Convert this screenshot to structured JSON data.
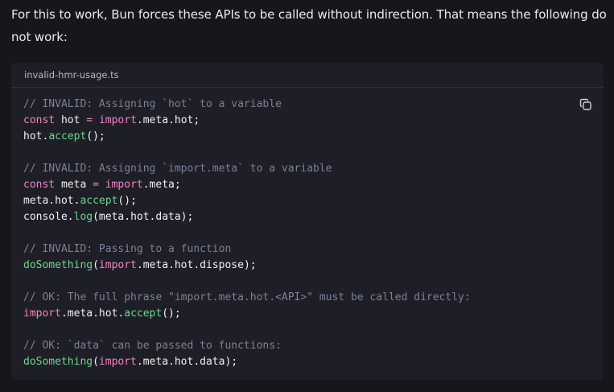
{
  "intro": {
    "text": "For this to work, Bun forces these APIs to be called without indirection. That means the following do not work:"
  },
  "code_block": {
    "filename": "invalid-hmr-usage.ts",
    "copy_icon": "copy-icon",
    "colors": {
      "background": "#1e1f26",
      "comment": "#7a7f9a",
      "keyword": "#f283c4",
      "function": "#6dd58c",
      "text": "#f1f1f3"
    },
    "lines": [
      [
        {
          "t": "comment",
          "v": "// INVALID: Assigning `hot` to a variable"
        }
      ],
      [
        {
          "t": "keyword",
          "v": "const"
        },
        {
          "t": "plain",
          "v": " hot "
        },
        {
          "t": "keyword",
          "v": "="
        },
        {
          "t": "plain",
          "v": " "
        },
        {
          "t": "keyword",
          "v": "import"
        },
        {
          "t": "plain",
          "v": ".meta.hot;"
        }
      ],
      [
        {
          "t": "plain",
          "v": "hot."
        },
        {
          "t": "function",
          "v": "accept"
        },
        {
          "t": "plain",
          "v": "();"
        }
      ],
      [],
      [
        {
          "t": "comment",
          "v": "// INVALID: Assigning `import.meta` to a variable"
        }
      ],
      [
        {
          "t": "keyword",
          "v": "const"
        },
        {
          "t": "plain",
          "v": " meta "
        },
        {
          "t": "keyword",
          "v": "="
        },
        {
          "t": "plain",
          "v": " "
        },
        {
          "t": "keyword",
          "v": "import"
        },
        {
          "t": "plain",
          "v": ".meta;"
        }
      ],
      [
        {
          "t": "plain",
          "v": "meta.hot."
        },
        {
          "t": "function",
          "v": "accept"
        },
        {
          "t": "plain",
          "v": "();"
        }
      ],
      [
        {
          "t": "plain",
          "v": "console."
        },
        {
          "t": "function",
          "v": "log"
        },
        {
          "t": "plain",
          "v": "(meta.hot.data);"
        }
      ],
      [],
      [
        {
          "t": "comment",
          "v": "// INVALID: Passing to a function"
        }
      ],
      [
        {
          "t": "function",
          "v": "doSomething"
        },
        {
          "t": "plain",
          "v": "("
        },
        {
          "t": "keyword",
          "v": "import"
        },
        {
          "t": "plain",
          "v": ".meta.hot.dispose);"
        }
      ],
      [],
      [
        {
          "t": "comment",
          "v": "// OK: The full phrase \"import.meta.hot.<API>\" must be called directly:"
        }
      ],
      [
        {
          "t": "keyword",
          "v": "import"
        },
        {
          "t": "plain",
          "v": ".meta.hot."
        },
        {
          "t": "function",
          "v": "accept"
        },
        {
          "t": "plain",
          "v": "();"
        }
      ],
      [],
      [
        {
          "t": "comment",
          "v": "// OK: `data` can be passed to functions:"
        }
      ],
      [
        {
          "t": "function",
          "v": "doSomething"
        },
        {
          "t": "plain",
          "v": "("
        },
        {
          "t": "keyword",
          "v": "import"
        },
        {
          "t": "plain",
          "v": ".meta.hot.data);"
        }
      ]
    ]
  }
}
